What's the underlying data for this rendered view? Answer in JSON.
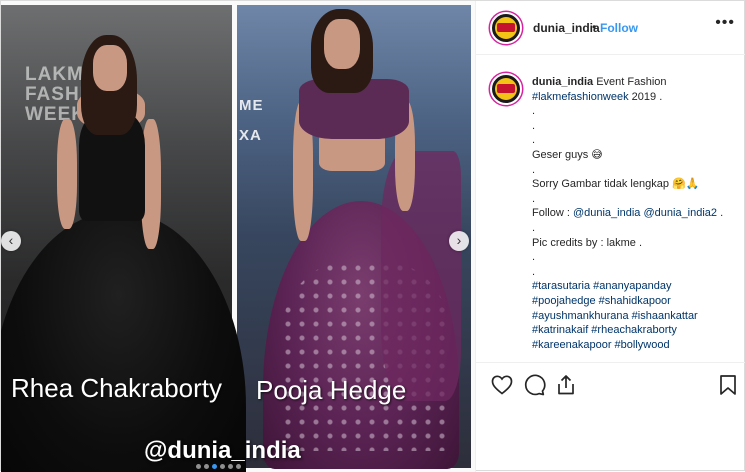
{
  "media": {
    "left_caption": "Rhea Chakraborty",
    "right_caption": "Pooja Hedge",
    "watermark": "@dunia_india",
    "bg_text_left": "LAKME FASHION WEEK",
    "bg_text_right_1": "ME",
    "bg_text_right_2": "XA",
    "prev_icon": "chevron-left-icon",
    "next_icon": "chevron-right-icon",
    "accent_color": "#3897f0"
  },
  "header": {
    "username": "dunia_india",
    "separator": "•",
    "follow_label": "Follow",
    "more_label": "•••"
  },
  "caption": {
    "username": "dunia_india",
    "line1_text": "Event Fashion",
    "line2_tag": "#lakmefashionweek",
    "line2_text": " 2019 .",
    "dots": [
      ".",
      ".",
      "."
    ],
    "geser": "Geser guys 😅",
    "dot_after_geser": ".",
    "sorry": "Sorry Gambar tidak lengkap 🤗🙏",
    "dot_after_sorry": ".",
    "follow_prefix": "Follow : ",
    "mention1": "@dunia_india",
    "mention2": "@dunia_india2",
    "follow_suffix": " .",
    "dot_after_follow": ".",
    "credits": "Pic credits by : lakme .",
    "dot_after_credits_1": ".",
    "dot_after_credits_2": ".",
    "hashtags": [
      "#tarasutaria #ananyapanday",
      "#poojahedge #shahidkapoor",
      "#ayushmankhurana #ishaankattar",
      "#katrinakaif #rheachakraborty",
      "#kareenakapoor #bollywood"
    ]
  },
  "actions": {
    "like_icon": "heart-icon",
    "comment_icon": "comment-icon",
    "share_icon": "share-icon",
    "save_icon": "bookmark-icon"
  }
}
